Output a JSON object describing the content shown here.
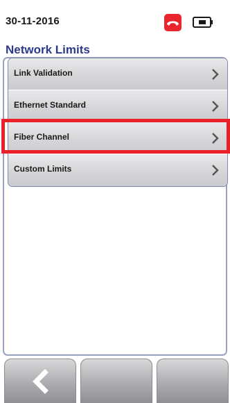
{
  "status_bar": {
    "date": "30-11-2016",
    "call_icon": "hangup-phone-icon",
    "battery_icon": "battery-icon"
  },
  "page": {
    "title": "Network Limits"
  },
  "menu": {
    "items": [
      {
        "label": "Link Validation",
        "icon": "chevron-right-icon"
      },
      {
        "label": "Ethernet Standard",
        "icon": "chevron-right-icon"
      },
      {
        "label": "Fiber Channel",
        "icon": "chevron-right-icon",
        "highlighted": true
      },
      {
        "label": "Custom Limits",
        "icon": "chevron-right-icon"
      }
    ]
  },
  "bottom_bar": {
    "buttons": [
      {
        "icon": "back-arrow-icon"
      },
      {
        "icon": ""
      },
      {
        "icon": ""
      }
    ]
  },
  "colors": {
    "title": "#2b3a8c",
    "highlight": "#e8202a",
    "call_icon_bg": "#e8262b",
    "panel_border": "#98a2c0"
  }
}
